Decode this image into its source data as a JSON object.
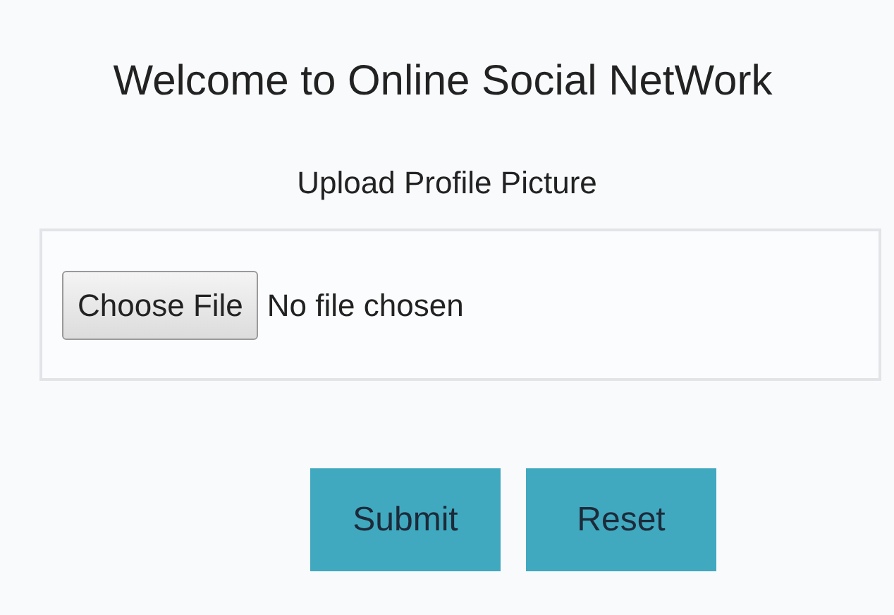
{
  "title": "Welcome to Online Social NetWork",
  "subtitle": "Upload Profile Picture",
  "file_input": {
    "button": "Choose File",
    "status": "No file chosen"
  },
  "buttons": [
    "Submit",
    "Reset"
  ]
}
